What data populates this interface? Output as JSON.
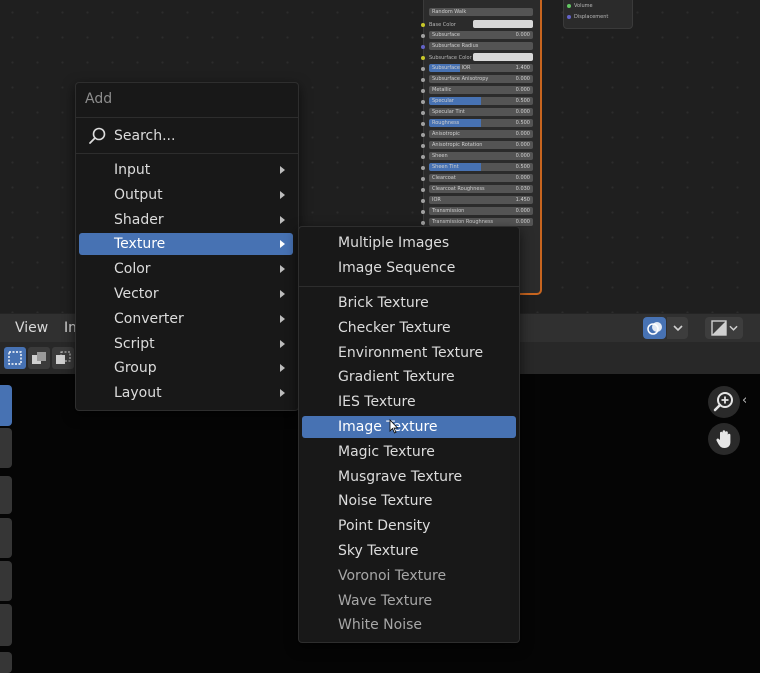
{
  "node_editor": {
    "bsdf_rows": [
      {
        "label": "Base Color",
        "type": "color"
      },
      {
        "label": "Subsurface",
        "value": "0.000"
      },
      {
        "label": "Subsurface Radius",
        "type": "dropdown"
      },
      {
        "label": "Subsurface Color",
        "type": "color"
      },
      {
        "label": "Subsurface IOR",
        "value": "1.400",
        "fill": 0.3
      },
      {
        "label": "Subsurface Anisotropy",
        "value": "0.000"
      },
      {
        "label": "Metallic",
        "value": "0.000"
      },
      {
        "label": "Specular",
        "value": "0.500",
        "fill": 0.5
      },
      {
        "label": "Specular Tint",
        "value": "0.000"
      },
      {
        "label": "Roughness",
        "value": "0.500",
        "fill": 0.5
      },
      {
        "label": "Anisotropic",
        "value": "0.000"
      },
      {
        "label": "Anisotropic Rotation",
        "value": "0.000"
      },
      {
        "label": "Sheen",
        "value": "0.000"
      },
      {
        "label": "Sheen Tint",
        "value": "0.500",
        "fill": 0.5
      },
      {
        "label": "Clearcoat",
        "value": "0.000"
      },
      {
        "label": "Clearcoat Roughness",
        "value": "0.030"
      },
      {
        "label": "IOR",
        "value": "1.450"
      },
      {
        "label": "Transmission",
        "value": "0.000"
      },
      {
        "label": "Transmission Roughness",
        "value": "0.000"
      }
    ],
    "subsurface_method": "Random Walk",
    "output_sockets": [
      "Volume",
      "Displacement"
    ]
  },
  "header": {
    "view_label": "View",
    "image_label": "Image"
  },
  "add_menu": {
    "title": "Add",
    "search_label": "Search...",
    "items": [
      {
        "label": "Input",
        "active": false
      },
      {
        "label": "Output",
        "active": false
      },
      {
        "label": "Shader",
        "active": false
      },
      {
        "label": "Texture",
        "active": true
      },
      {
        "label": "Color",
        "active": false
      },
      {
        "label": "Vector",
        "active": false
      },
      {
        "label": "Converter",
        "active": false
      },
      {
        "label": "Script",
        "active": false
      },
      {
        "label": "Group",
        "active": false
      },
      {
        "label": "Layout",
        "active": false
      }
    ]
  },
  "texture_menu": {
    "group1": [
      "Multiple Images",
      "Image Sequence"
    ],
    "group2": [
      "Brick Texture",
      "Checker Texture",
      "Environment Texture",
      "Gradient Texture",
      "IES Texture",
      "Image Texture",
      "Magic Texture",
      "Musgrave Texture",
      "Noise Texture",
      "Point Density",
      "Sky Texture",
      "Voronoi Texture",
      "Wave Texture",
      "White Noise"
    ],
    "active_item": "Image Texture"
  },
  "colors": {
    "accent": "#4772b3",
    "menu_bg": "#181818",
    "node_border": "#c8651f"
  },
  "icons": [
    "search-icon",
    "chevron-right-icon",
    "zoom-in-icon",
    "hand-icon",
    "overlay-icon",
    "display-mode-icon",
    "select-box-icon",
    "mouse-cursor-icon"
  ]
}
